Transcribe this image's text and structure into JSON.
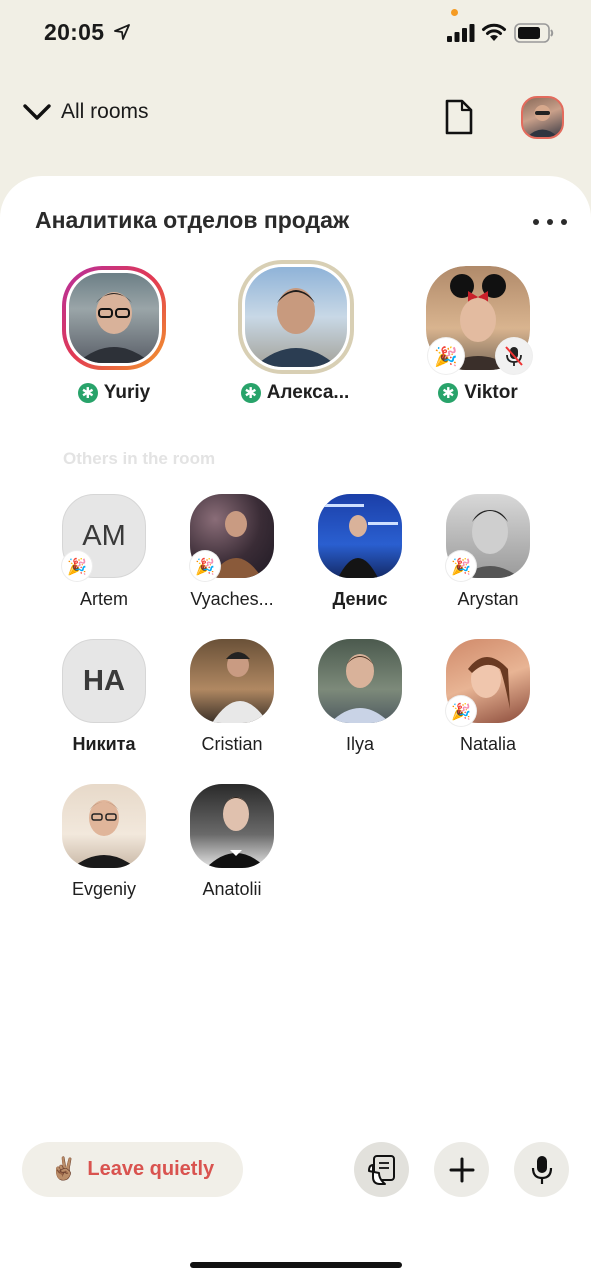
{
  "status_bar": {
    "time": "20:05"
  },
  "header": {
    "rooms_label": "All rooms"
  },
  "room": {
    "title": "Аналитика отделов продаж"
  },
  "speakers": [
    {
      "name": "Yuriy",
      "moderator": true
    },
    {
      "name": "Алекса...",
      "moderator": true
    },
    {
      "name": "Viktor",
      "moderator": true,
      "badges": [
        "party-popper-icon",
        "mic-muted-icon"
      ]
    }
  ],
  "others_label": "Others in the room",
  "listeners": [
    {
      "name": "Artem",
      "initials": "AM",
      "badge": "party-popper-icon"
    },
    {
      "name": "Vyaches...",
      "badge": "party-popper-icon"
    },
    {
      "name": "Денис"
    },
    {
      "name": "Arystan",
      "badge": "party-popper-icon"
    },
    {
      "name": "Никита",
      "initials": "HA"
    },
    {
      "name": "Cristian"
    },
    {
      "name": "Ilya"
    },
    {
      "name": "Natalia",
      "badge": "party-popper-icon"
    },
    {
      "name": "Evgeniy"
    },
    {
      "name": "Anatolii"
    }
  ],
  "bottom_bar": {
    "leave_label": "Leave quietly",
    "leave_emoji": "✌🏽"
  },
  "colors": {
    "background": "#f1efe5",
    "card": "#ffffff",
    "moderator_green": "#28a36a",
    "leave_red": "#d9534f"
  }
}
